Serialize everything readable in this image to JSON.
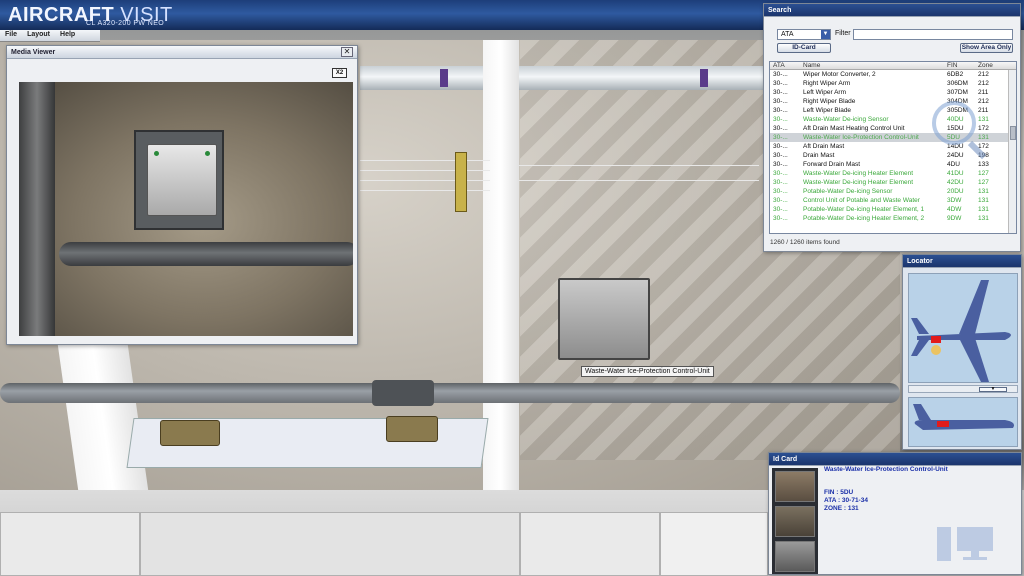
{
  "app": {
    "title_a": "AIRCRAFT",
    "title_b": "VISIT",
    "subtitle": "CL A320-200 PW NEO"
  },
  "menu": [
    "File",
    "Layout",
    "Help"
  ],
  "media_viewer": {
    "title": "Media Viewer",
    "zoom_label": "X2"
  },
  "scene": {
    "tooltip": "Waste-Water Ice-Protection Control-Unit"
  },
  "search": {
    "title": "Search",
    "ata_value": "ATA",
    "filter_label": "Filter :",
    "filter_value": "",
    "idcard_button": "ID-Card",
    "show_area_button": "Show Area Only",
    "columns": [
      "ATA",
      "Name",
      "FIN",
      "Zone"
    ],
    "rows": [
      {
        "ata": "30-...",
        "name": "Wiper Motor Converter, 2",
        "fin": "6DB2",
        "zone": "212",
        "style": "normal"
      },
      {
        "ata": "30-...",
        "name": "Right Wiper Arm",
        "fin": "306DM",
        "zone": "212",
        "style": "normal"
      },
      {
        "ata": "30-...",
        "name": "Left Wiper Arm",
        "fin": "307DM",
        "zone": "211",
        "style": "normal"
      },
      {
        "ata": "30-...",
        "name": "Right Wiper Blade",
        "fin": "304DM",
        "zone": "212",
        "style": "normal"
      },
      {
        "ata": "30-...",
        "name": "Left Wiper Blade",
        "fin": "305DM",
        "zone": "211",
        "style": "normal"
      },
      {
        "ata": "30-...",
        "name": "Waste-Water De-icing Sensor",
        "fin": "40DU",
        "zone": "131",
        "style": "green"
      },
      {
        "ata": "30-...",
        "name": "Aft Drain Mast Heating Control Unit",
        "fin": "15DU",
        "zone": "172",
        "style": "normal"
      },
      {
        "ata": "30-...",
        "name": "Waste-Water Ice-Protection Control-Unit",
        "fin": "5DU",
        "zone": "131",
        "style": "selected"
      },
      {
        "ata": "30-...",
        "name": "Aft Drain Mast",
        "fin": "14DU",
        "zone": "172",
        "style": "normal"
      },
      {
        "ata": "30-...",
        "name": "Drain Mast",
        "fin": "24DU",
        "zone": "198",
        "style": "normal"
      },
      {
        "ata": "30-...",
        "name": "Forward Drain Mast",
        "fin": "4DU",
        "zone": "133",
        "style": "normal"
      },
      {
        "ata": "30-...",
        "name": "Waste-Water De-icing Heater Element",
        "fin": "41DU",
        "zone": "127",
        "style": "green"
      },
      {
        "ata": "30-...",
        "name": "Waste-Water De-icing Heater Element",
        "fin": "42DU",
        "zone": "127",
        "style": "green"
      },
      {
        "ata": "30-...",
        "name": "Potable-Water De-icing Sensor",
        "fin": "20DU",
        "zone": "131",
        "style": "green"
      },
      {
        "ata": "30-...",
        "name": "Control Unit of Potable and Waste Water",
        "fin": "3DW",
        "zone": "131",
        "style": "green"
      },
      {
        "ata": "30-...",
        "name": "Potable-Water De-icing Heater Element, 1",
        "fin": "4DW",
        "zone": "131",
        "style": "green"
      },
      {
        "ata": "30-...",
        "name": "Potable-Water De-icing Heater Element, 2",
        "fin": "9DW",
        "zone": "131",
        "style": "green"
      }
    ],
    "items_found": "1260 / 1260 items found"
  },
  "locator": {
    "title": "Locator"
  },
  "idcard": {
    "title": "Id Card",
    "name": "Waste-Water Ice-Protection Control-Unit",
    "fin": "FIN : 5DU",
    "ata": "ATA : 30-71-34",
    "zone": "ZONE : 131"
  },
  "colors": {
    "header_blue": "#2f5aa0",
    "selected_green": "#4da84d",
    "list_green": "#3aa83a",
    "idcard_text": "#1a2fa8",
    "locator_highlight": "#e21b1b"
  }
}
